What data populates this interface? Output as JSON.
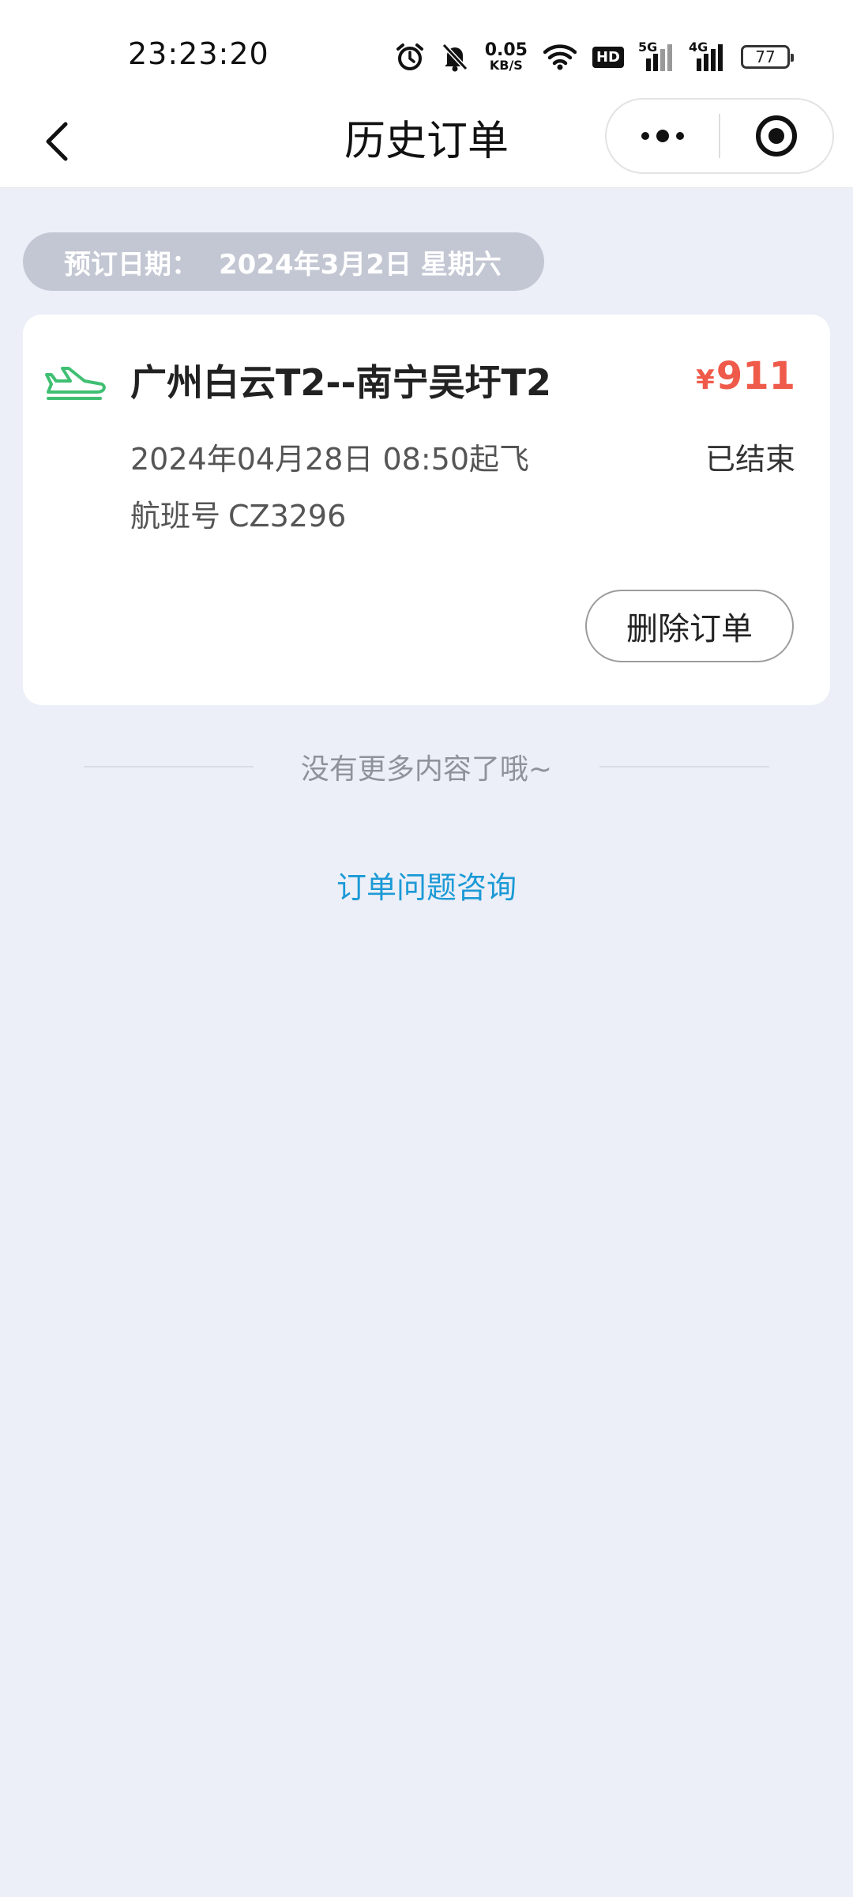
{
  "status_bar": {
    "time": "23:23:20",
    "net_speed_value": "0.05",
    "net_speed_unit": "KB/S",
    "hd_label": "HD",
    "signal_1_label": "5G",
    "signal_2_label": "4G",
    "battery": "77",
    "icons": [
      "alarm-icon",
      "mute-bell-icon",
      "wifi-icon",
      "hd-icon",
      "signal-5g-icon",
      "signal-4g-icon",
      "battery-icon"
    ]
  },
  "nav": {
    "title": "历史订单",
    "icons": [
      "back-chevron-icon",
      "more-dots-icon",
      "target-circle-icon"
    ]
  },
  "booking": {
    "label": "预订日期：",
    "date": "2024年3月2日 星期六"
  },
  "order": {
    "route": "广州白云T2--南宁吴圩T2",
    "currency": "¥",
    "price": "911",
    "depart": "2024年04月28日 08:50起飞",
    "status": "已结束",
    "flight_label": "航班号",
    "flight_no": "CZ3296",
    "delete_label": "删除订单",
    "icon": "plane-icon"
  },
  "footer": {
    "no_more": "没有更多内容了哦~",
    "consult": "订单问题咨询"
  },
  "colors": {
    "background": "#eceff7",
    "price": "#ef5a4a",
    "plane": "#3fbf72",
    "link": "#1b9ad6",
    "date_pill": "#c3c7d3"
  }
}
